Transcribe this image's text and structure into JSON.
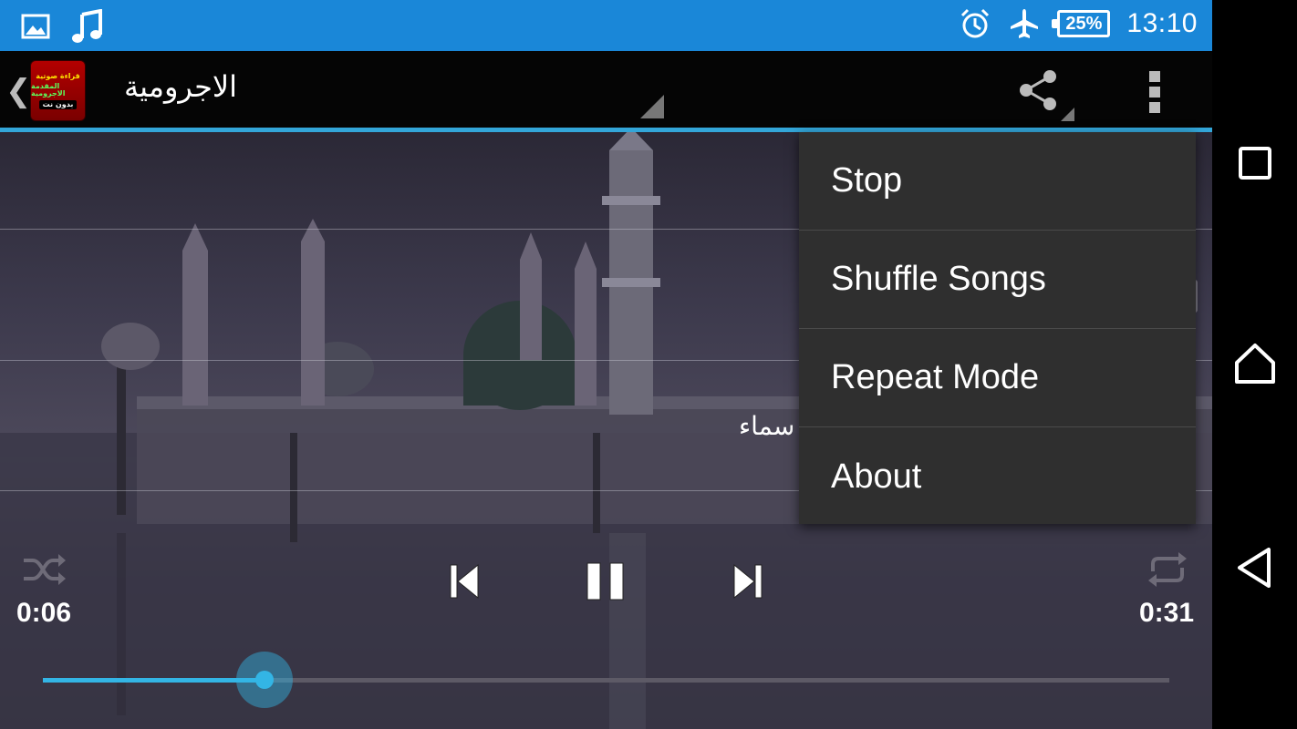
{
  "status_bar": {
    "time": "13:10",
    "battery": "25%",
    "icons": [
      "image-icon",
      "music-note-icon",
      "alarm-icon",
      "airplane-mode-icon",
      "battery-icon"
    ],
    "background": "#1a87d8"
  },
  "action_bar": {
    "title": "الاجرومية",
    "app_icon_lines": [
      "قراءة صوتية",
      "المقدمة الاجرومية",
      "بدون نت"
    ],
    "icons": [
      "up-chevron-icon",
      "share-icon",
      "overflow-menu-icon"
    ],
    "accent": "#33a6d9"
  },
  "content": {
    "lyric_text": "سماء"
  },
  "menu": {
    "items": [
      {
        "label": "Stop"
      },
      {
        "label": "Shuffle Songs"
      },
      {
        "label": "Repeat Mode"
      },
      {
        "label": "About"
      }
    ]
  },
  "player": {
    "elapsed": "0:06",
    "duration": "0:31",
    "progress": 0.197,
    "controls": [
      "shuffle-icon",
      "previous-icon",
      "pause-icon",
      "next-icon",
      "repeat-icon"
    ],
    "seek_color": "#33b5e5"
  },
  "nav_bar": {
    "buttons": [
      "recent-apps-icon",
      "home-icon",
      "back-icon"
    ]
  }
}
